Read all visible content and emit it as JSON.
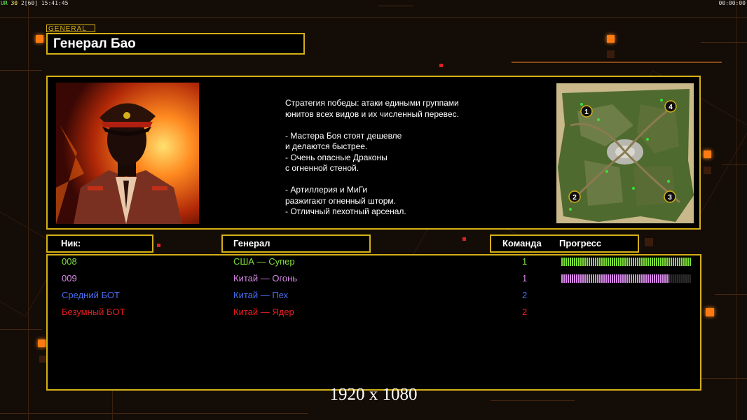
{
  "debug": {
    "left_prefix": "UR",
    "left_fps": "30",
    "left_fps2": "2",
    "left_bracket": "[60]",
    "left_time": "15:41:45",
    "right_time": "00:00:00"
  },
  "general_tag": "GENERAL",
  "general_name": "Генерал Бао",
  "description": [
    "Стратегия победы: атаки едиными группами",
    "юнитов всех видов и их численный перевес.",
    "",
    "- Мастера Боя стоят дешевле",
    "и делаются быстрее.",
    "- Очень опасные Драконы",
    "с огненной стеной.",
    "",
    "- Артиллерия и МиГи",
    "разжигают огненный шторм.",
    "- Отличный пехотный арсенал."
  ],
  "map": {
    "start_positions": [
      "1",
      "2",
      "3",
      "4"
    ]
  },
  "headers": {
    "nick": "Ник:",
    "general": "Генерал",
    "team": "Команда",
    "progress": "Прогресс"
  },
  "players": [
    {
      "nick": "008",
      "general": "США — Супер",
      "team": "1",
      "color": "#7fe03a",
      "progress": 1.0
    },
    {
      "nick": "009",
      "general": "Китай — Огонь",
      "team": "1",
      "color": "#d78ae8",
      "progress": 0.83
    },
    {
      "nick": "Средний БОТ",
      "general": "Китай — Пех",
      "team": "2",
      "color": "#4a6ef0",
      "progress": null
    },
    {
      "nick": "Безумный БОТ",
      "general": "Китай — Ядер",
      "team": "2",
      "color": "#e81e1e",
      "progress": null
    }
  ],
  "resolution_label": "1920 x 1080",
  "colors": {
    "accent_gold": "#d4b018",
    "background": "#140c07",
    "glow_orange": "#ff7a12"
  }
}
